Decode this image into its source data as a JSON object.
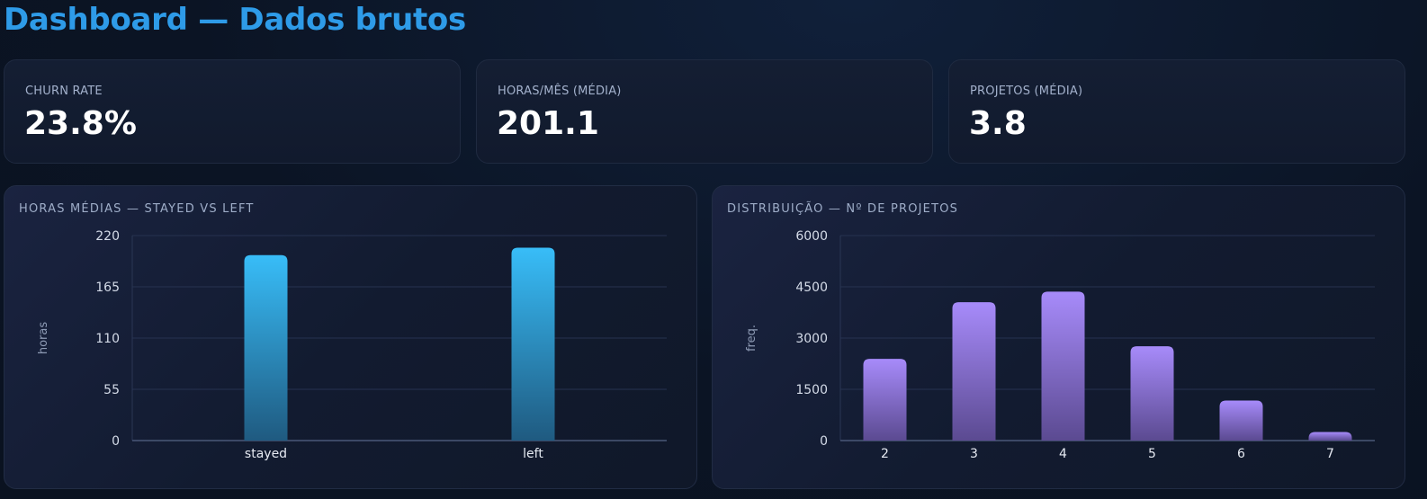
{
  "page": {
    "title": "Dashboard — Dados brutos"
  },
  "kpis": [
    {
      "label": "CHURN RATE",
      "value": "23.8%"
    },
    {
      "label": "HORAS/MÊS (MÉDIA)",
      "value": "201.1"
    },
    {
      "label": "PROJETOS (MÉDIA)",
      "value": "3.8"
    }
  ],
  "colors": {
    "accent": "#2e9be8",
    "bar_blue_top": "#38bdf8",
    "bar_blue_bottom": "#1f5a80",
    "bar_purple_top": "#a78bfa",
    "bar_purple_bottom": "#5b4a91"
  },
  "chart_data": [
    {
      "type": "bar",
      "title": "HORAS MÉDIAS — STAYED VS LEFT",
      "categories": [
        "stayed",
        "left"
      ],
      "values": [
        199,
        207
      ],
      "ylabel": "horas",
      "xlabel": "",
      "ylim": [
        0,
        220
      ],
      "yticks": [
        "0",
        "55",
        "110",
        "165",
        "220"
      ],
      "grid": true,
      "legend": "none"
    },
    {
      "type": "bar",
      "title": "DISTRIBUIÇÃO — Nº DE PROJETOS",
      "categories": [
        "2",
        "3",
        "4",
        "5",
        "6",
        "7"
      ],
      "values": [
        2390,
        4050,
        4360,
        2760,
        1170,
        250
      ],
      "ylabel": "freq.",
      "xlabel": "",
      "ylim": [
        0,
        6000
      ],
      "yticks": [
        "0",
        "1500",
        "3000",
        "4500",
        "6000"
      ],
      "grid": true,
      "legend": "none"
    }
  ]
}
